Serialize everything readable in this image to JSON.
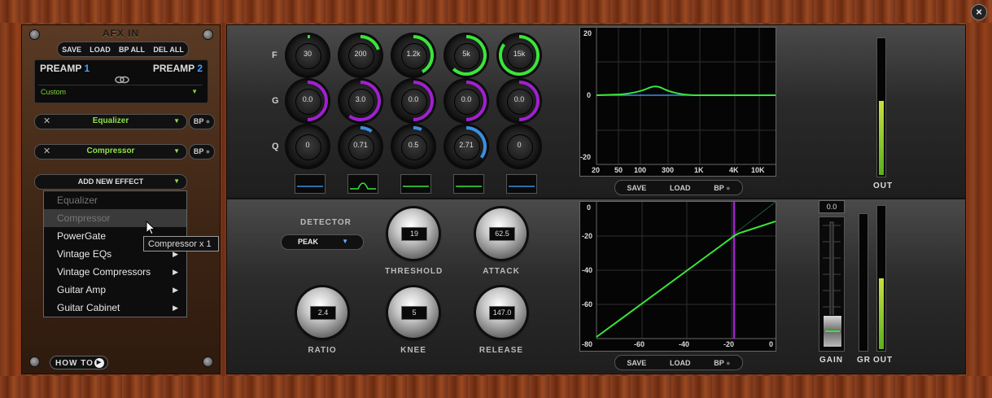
{
  "window": {
    "close_label": "×"
  },
  "left_panel": {
    "title": "AFX IN",
    "preset_buttons": [
      "SAVE",
      "LOAD",
      "BP ALL",
      "DEL ALL"
    ],
    "preamp": {
      "label_left": "PREAMP",
      "num_left": "1",
      "label_right": "PREAMP",
      "num_right": "2",
      "selected": "Custom"
    },
    "slots": [
      {
        "name": "Equalizer",
        "bp": "BP"
      },
      {
        "name": "Compressor",
        "bp": "BP"
      }
    ],
    "add_effect": "ADD NEW EFFECT",
    "menu": [
      {
        "label": "Equalizer",
        "disabled": true,
        "submenu": false
      },
      {
        "label": "Compressor",
        "disabled": true,
        "submenu": false
      },
      {
        "label": "PowerGate",
        "disabled": false,
        "submenu": false
      },
      {
        "label": "Vintage EQs",
        "disabled": false,
        "submenu": true
      },
      {
        "label": "Vintage Compressors",
        "disabled": false,
        "submenu": true
      },
      {
        "label": "Guitar Amp",
        "disabled": false,
        "submenu": true
      },
      {
        "label": "Guitar Cabinet",
        "disabled": false,
        "submenu": true
      }
    ],
    "tooltip": "Compressor x 1",
    "howto": "HOW TO"
  },
  "eq": {
    "row_labels": [
      "F",
      "G",
      "Q"
    ],
    "bands": [
      {
        "f": "30",
        "g": "0.0",
        "q": "0",
        "f_level": 0.02,
        "g_level": 0.5,
        "q_level": 0.0
      },
      {
        "f": "200",
        "g": "3.0",
        "q": "0.71",
        "f_level": 0.2,
        "g_level": 0.6,
        "q_level": 0.1
      },
      {
        "f": "1.2k",
        "g": "0.0",
        "q": "0.5",
        "f_level": 0.42,
        "g_level": 0.5,
        "q_level": 0.07
      },
      {
        "f": "5k",
        "g": "0.0",
        "q": "2.71",
        "f_level": 0.62,
        "g_level": 0.5,
        "q_level": 0.35
      },
      {
        "f": "15k",
        "g": "0.0",
        "q": "0",
        "f_level": 0.85,
        "g_level": 0.5,
        "q_level": 0.0
      }
    ],
    "graph": {
      "y_labels": [
        "20",
        "0",
        "-20"
      ],
      "x_labels": [
        "20",
        "50",
        "100",
        "300",
        "1K",
        "4K",
        "10K"
      ]
    },
    "buttons": [
      "SAVE",
      "LOAD",
      "BP"
    ],
    "out_label": "OUT",
    "out_level": 0.55
  },
  "comp": {
    "detector_label": "DETECTOR",
    "detector_value": "PEAK",
    "threshold": "19",
    "attack": "62.5",
    "ratio": "2.4",
    "knee": "5",
    "release": "147.0",
    "labels": {
      "threshold": "THRESHOLD",
      "attack": "ATTACK",
      "ratio": "RATIO",
      "knee": "KNEE",
      "release": "RELEASE"
    },
    "graph": {
      "y_labels": [
        "0",
        "-20",
        "-40",
        "-60",
        "-80"
      ],
      "x_labels": [
        "-80",
        "-60",
        "-40",
        "-20",
        "0"
      ]
    },
    "buttons": [
      "SAVE",
      "LOAD",
      "BP"
    ],
    "gain_value": "0.0",
    "gain_label": "GAIN",
    "gr_label": "GR",
    "out_label": "OUT",
    "out_level": 0.5
  },
  "colors": {
    "accent_green": "#39e639",
    "accent_purple": "#a020d0",
    "accent_blue": "#3a8fe0",
    "wood": "#7a3518"
  }
}
